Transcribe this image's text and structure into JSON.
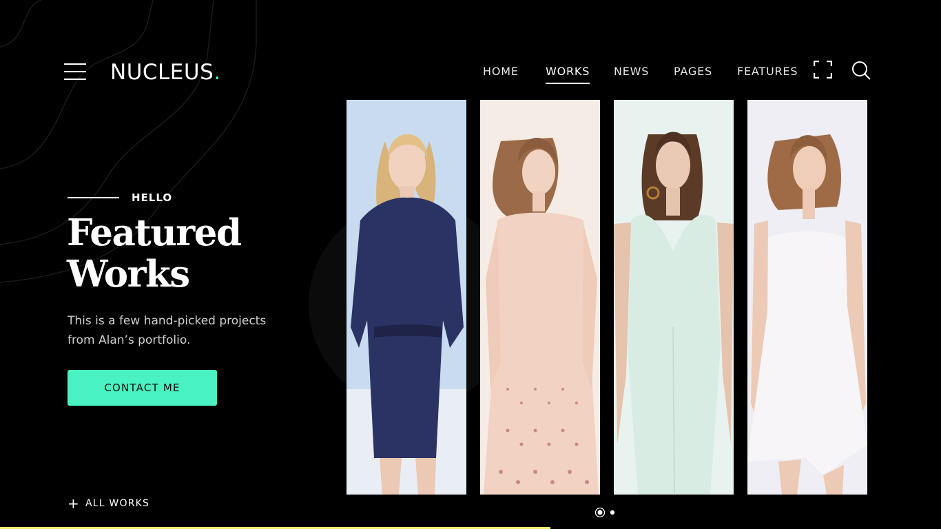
{
  "brand": {
    "name": "NUCLEUS",
    "dot": ".",
    "accent": "#48f2c1"
  },
  "nav": {
    "items": [
      {
        "label": "HOME"
      },
      {
        "label": "WORKS",
        "active": true
      },
      {
        "label": "NEWS"
      },
      {
        "label": "PAGES"
      },
      {
        "label": "FEATURES"
      }
    ]
  },
  "header_icons": [
    "hamburger-menu-icon",
    "fullscreen-icon",
    "search-icon"
  ],
  "hero": {
    "eyebrow": "HELLO",
    "title_line1": "Featured",
    "title_line2": "Works",
    "description": "This is a few hand-picked projects from Alan’s portfolio.",
    "cta_label": "CONTACT ME",
    "cta_color": "#48f2c1"
  },
  "footer": {
    "all_works_label": "ALL WORKS"
  },
  "gallery": {
    "items": [
      {
        "name": "navy-dress",
        "dress_color": "#2b3365",
        "bg": "#c9dcef"
      },
      {
        "name": "pink-lace-dress",
        "dress_color": "#f2d2c2",
        "bg": "#f6ece6"
      },
      {
        "name": "mint-jumpsuit",
        "dress_color": "#d9ece4",
        "bg": "#e8f3ef"
      },
      {
        "name": "white-dress",
        "dress_color": "#f7f5f7",
        "bg": "#eeeef4"
      }
    ],
    "pagination": {
      "total": 2,
      "current": 1
    }
  },
  "progress_bar_color": "#f2ee72"
}
